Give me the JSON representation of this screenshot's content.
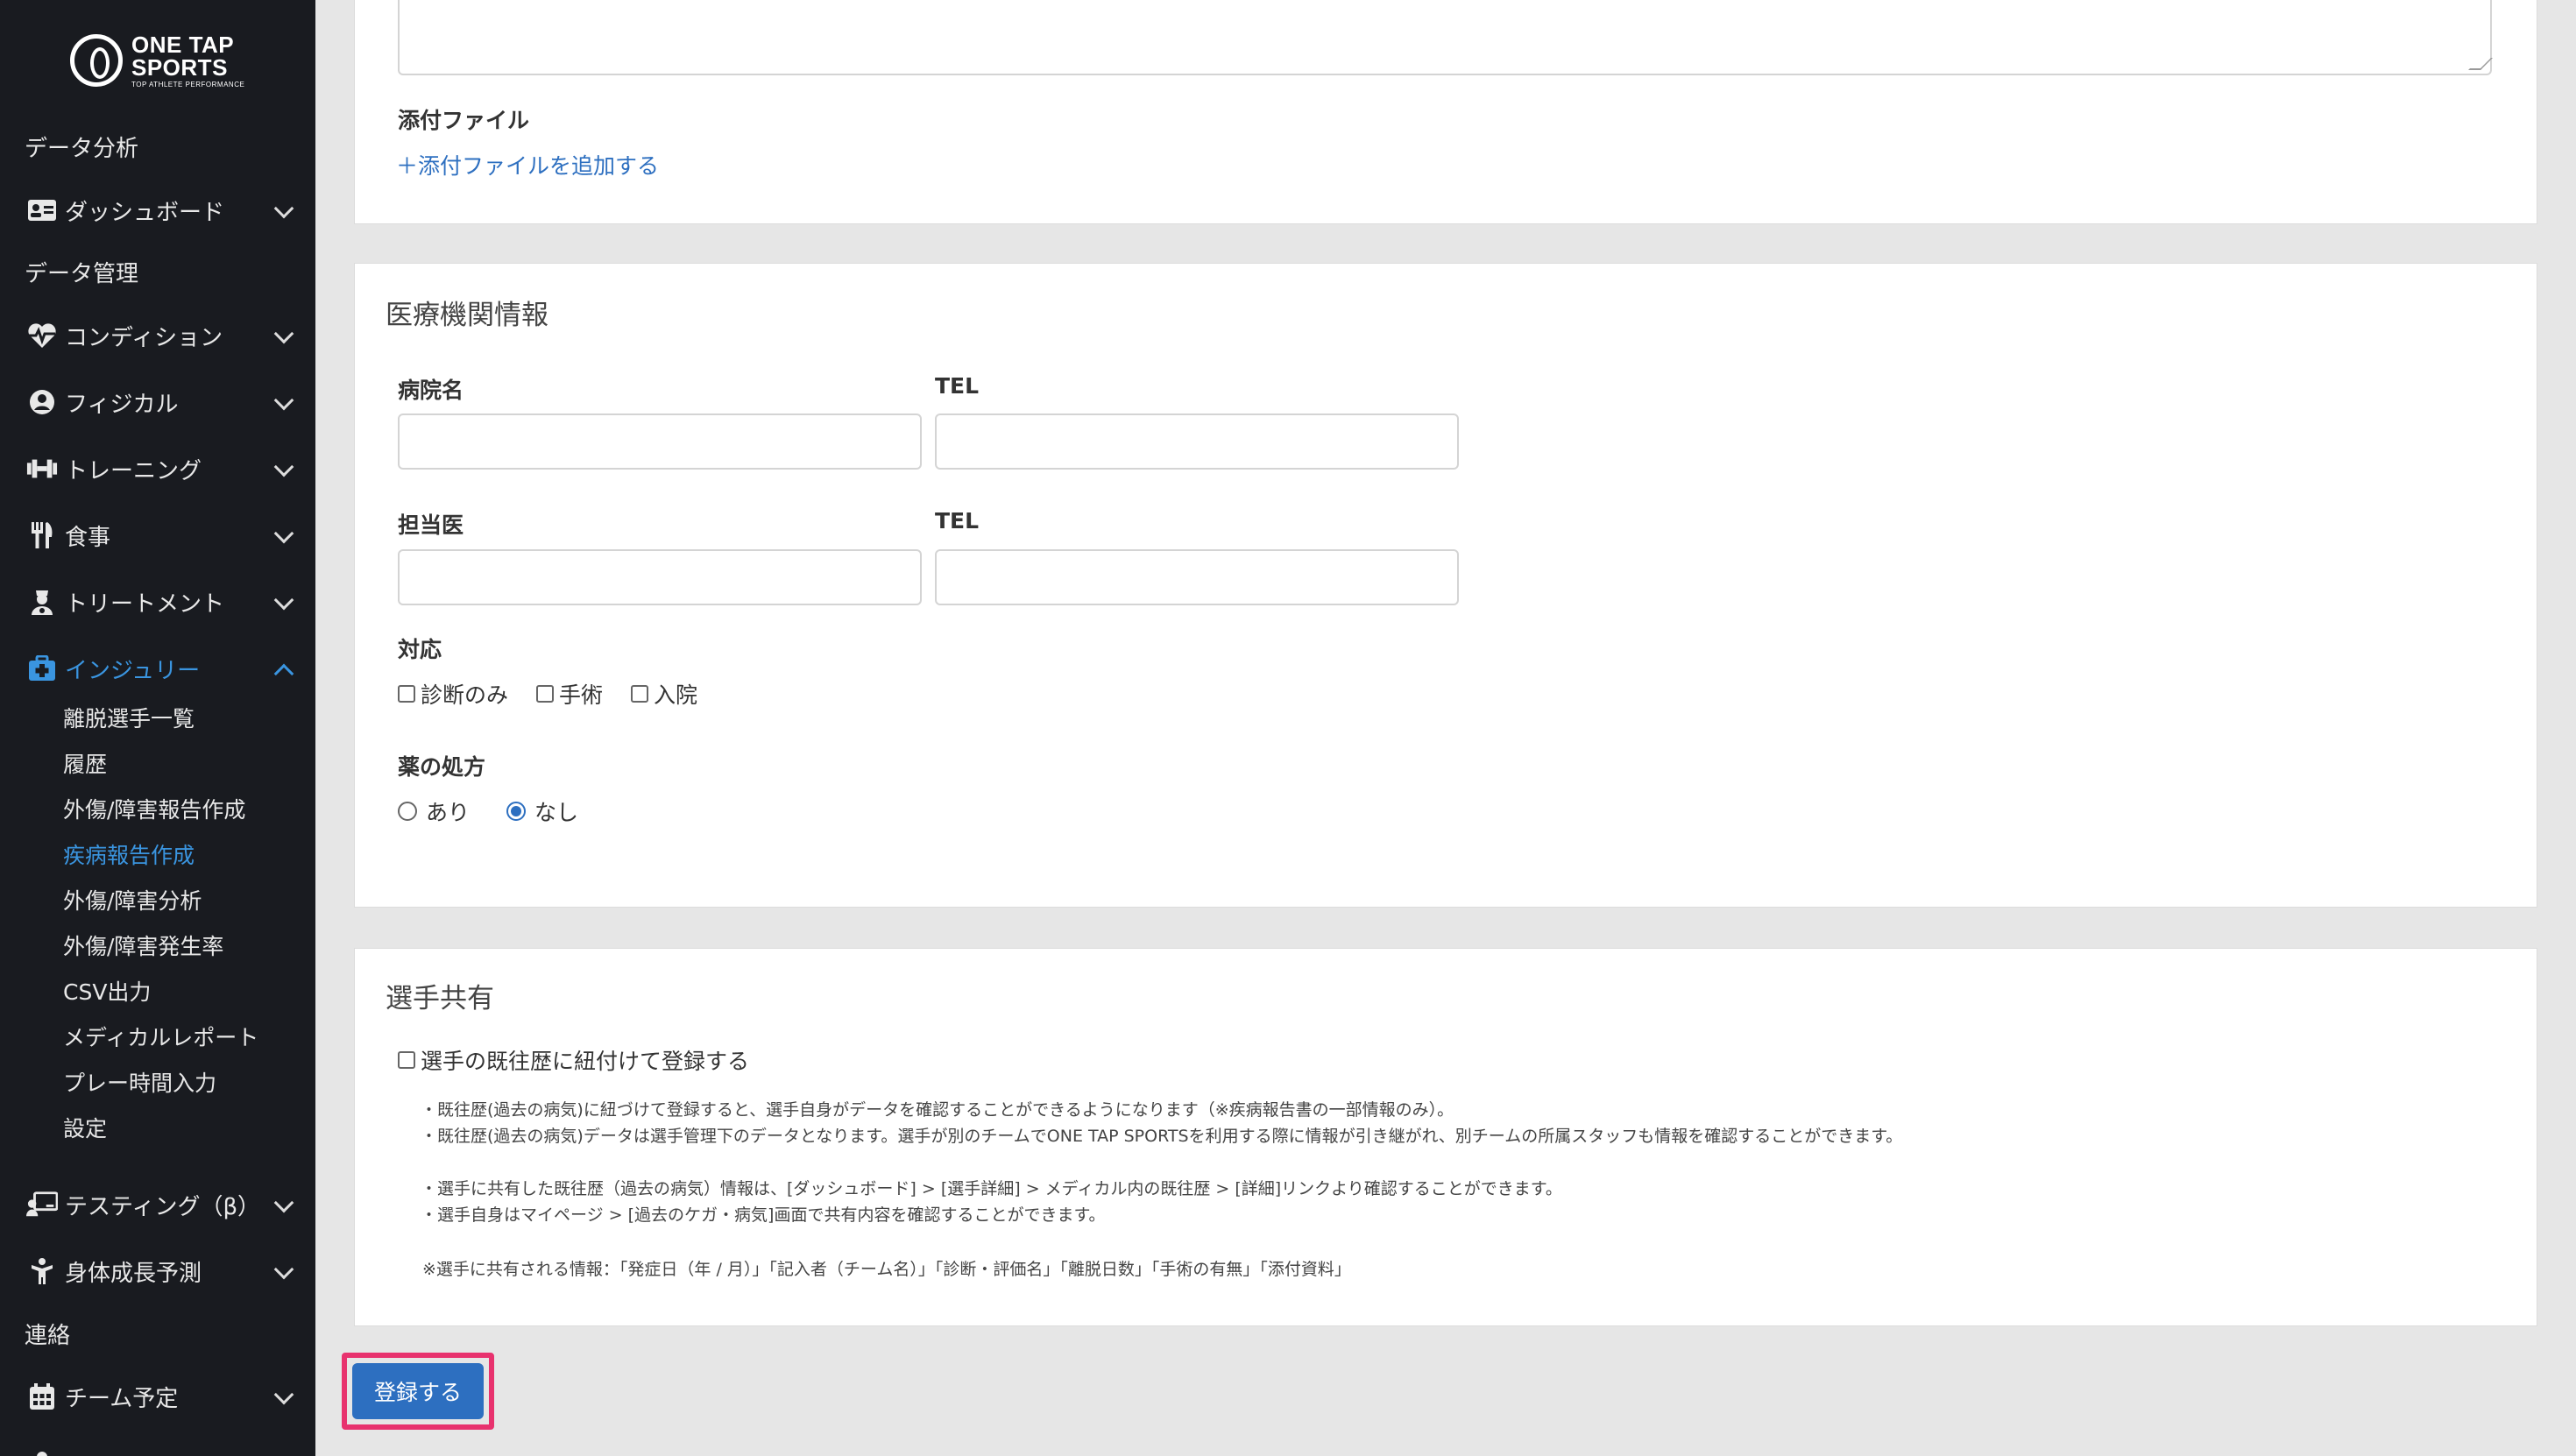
{
  "brand": {
    "line1": "ONE TAP",
    "line2": "SPORTS",
    "tagline": "TOP ATHLETE PERFORMANCE"
  },
  "sidebar": {
    "items": [
      {
        "label": "データ分析",
        "icon": "none"
      },
      {
        "label": "ダッシュボード",
        "icon": "id-card-icon"
      },
      {
        "label": "データ管理",
        "icon": "none"
      },
      {
        "label": "コンディション",
        "icon": "heartbeat-icon"
      },
      {
        "label": "フィジカル",
        "icon": "user-circle-icon"
      },
      {
        "label": "トレーニング",
        "icon": "dumbbell-icon"
      },
      {
        "label": "食事",
        "icon": "utensils-icon"
      },
      {
        "label": "トリートメント",
        "icon": "user-nurse-icon"
      },
      {
        "label": "インジュリー",
        "icon": "medkit-icon"
      },
      {
        "label": "テスティング（β）",
        "icon": "chalkboard-user-icon"
      },
      {
        "label": "身体成長予測",
        "icon": "child-icon"
      },
      {
        "label": "連絡",
        "icon": "none"
      },
      {
        "label": "チーム予定",
        "icon": "calendar-icon"
      }
    ],
    "injury_sub": [
      "離脱選手一覧",
      "履歴",
      "外傷/障害報告作成",
      "疾病報告作成",
      "外傷/障害分析",
      "外傷/障害発生率",
      "CSV出力",
      "メディカルレポート",
      "プレー時間入力",
      "設定"
    ]
  },
  "attachments": {
    "label": "添付ファイル",
    "add_link": "＋添付ファイルを追加する"
  },
  "medical": {
    "title": "医療機関情報",
    "hospital_label": "病院名",
    "tel_label_1": "TEL",
    "doctor_label": "担当医",
    "tel_label_2": "TEL",
    "hospital_value": "",
    "tel_value_1": "",
    "doctor_value": "",
    "tel_value_2": "",
    "response_label": "対応",
    "response_options": [
      "診断のみ",
      "手術",
      "入院"
    ],
    "prescription_label": "薬の処方",
    "prescription_options": [
      "あり",
      "なし"
    ],
    "prescription_selected": "なし"
  },
  "share": {
    "title": "選手共有",
    "checkbox_label": "選手の既往歴に紐付けて登録する",
    "notes": [
      "・既往歴(過去の病気)に紐づけて登録すると、選手自身がデータを確認することができるようになります（※疾病報告書の一部情報のみ）。",
      "・既往歴(過去の病気)データは選手管理下のデータとなります。選手が別のチームでONE TAP SPORTSを利用する際に情報が引き継がれ、別チームの所属スタッフも情報を確認することができます。",
      "・選手に共有した既往歴（過去の病気）情報は、[ダッシュボード] > [選手詳細] > メディカル内の既往歴 > [詳細]リンクより確認することができます。",
      "・選手自身はマイページ > [過去のケガ・病気]画面で共有内容を確認することができます。",
      "※選手に共有される情報：「発症日（年 / 月）」「記入者（チーム名）」「診断・評価名」「離脱日数」「手術の有無」「添付資料」"
    ]
  },
  "submit_label": "登録する",
  "colors": {
    "sidebar_bg": "#191b20",
    "accent": "#3a95e0",
    "button": "#2d6fc0",
    "highlight": "#e8326e"
  }
}
